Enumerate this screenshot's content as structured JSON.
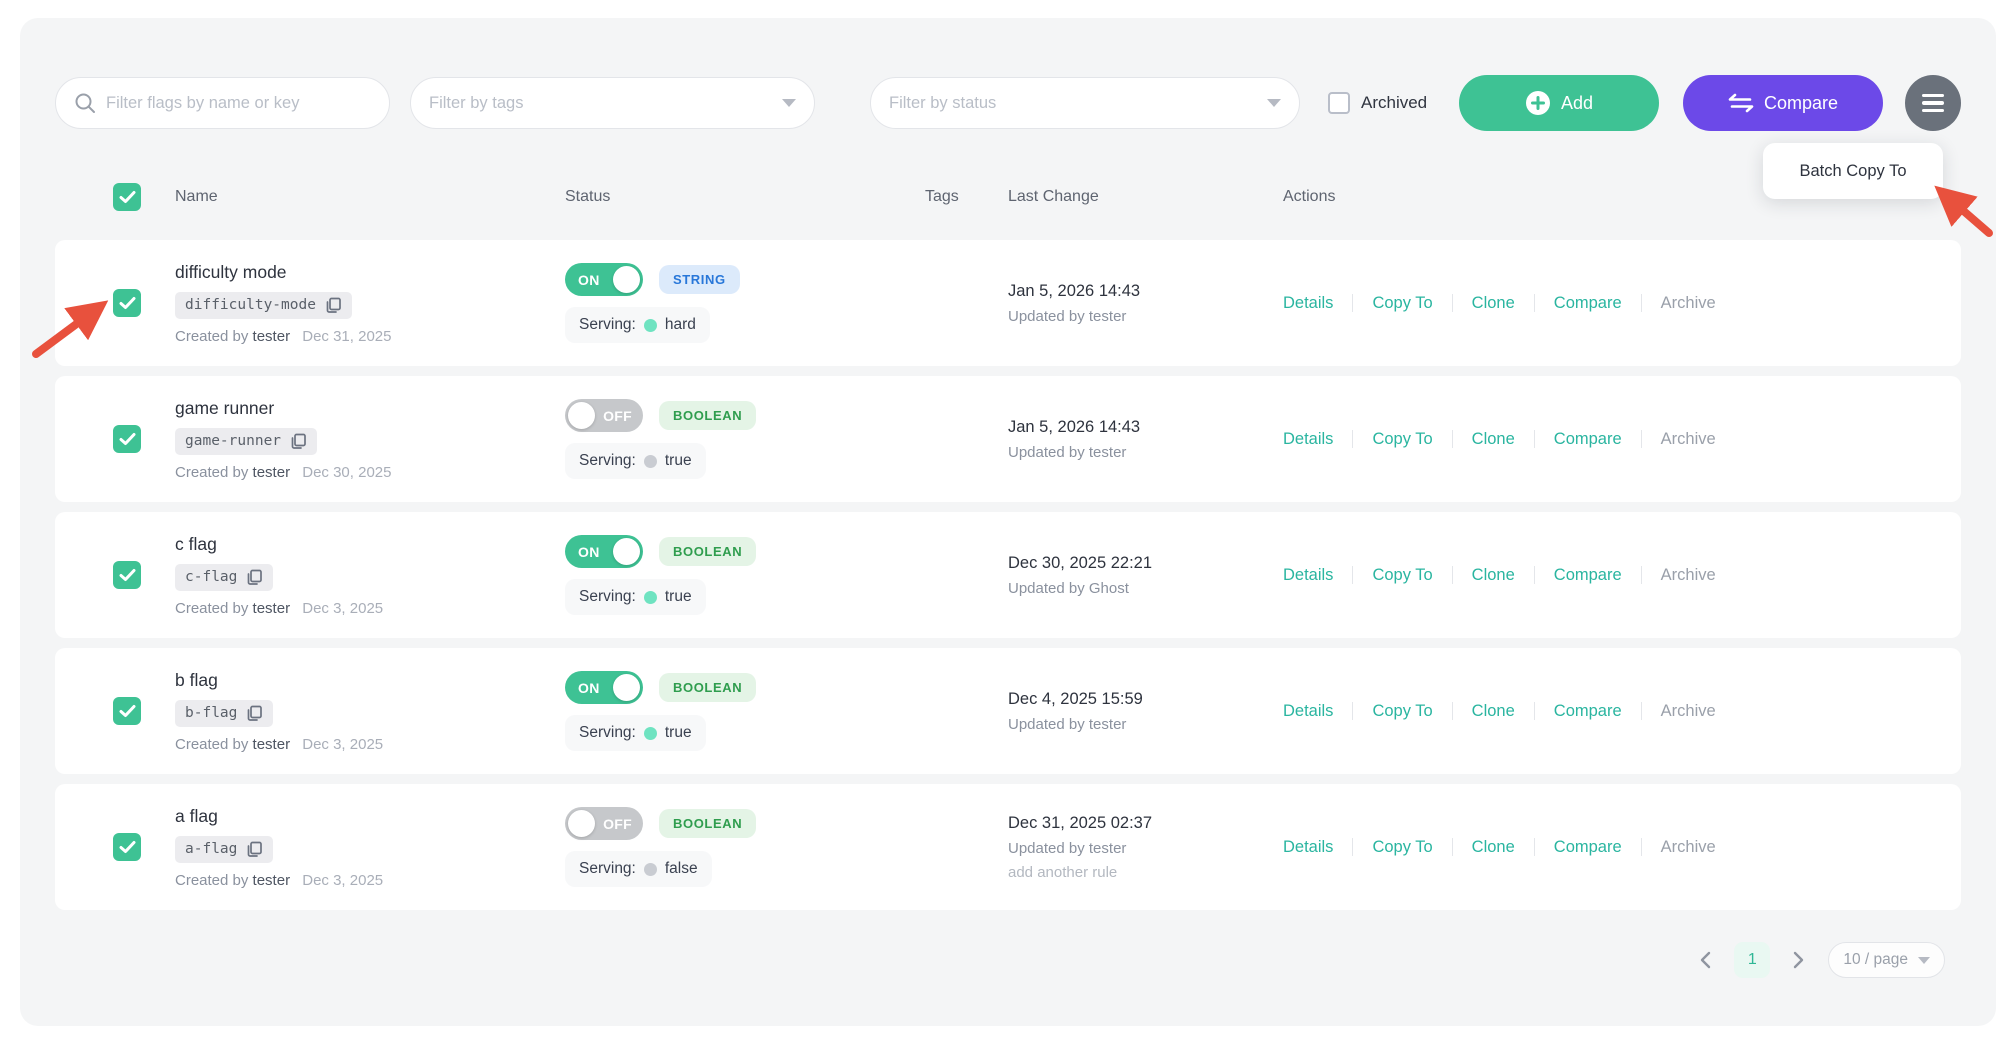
{
  "filters": {
    "search_placeholder": "Filter flags by name or key",
    "tags_placeholder": "Filter by tags",
    "status_placeholder": "Filter by status",
    "archived_label": "Archived"
  },
  "toolbar": {
    "add_label": "Add",
    "compare_label": "Compare",
    "menu_popover_label": "Batch Copy To"
  },
  "table": {
    "headers": {
      "name": "Name",
      "status": "Status",
      "tags": "Tags",
      "last_change": "Last Change",
      "actions": "Actions"
    },
    "rows": [
      {
        "name": "difficulty mode",
        "key": "difficulty-mode",
        "created_prefix": "Created by",
        "created_user": "tester",
        "created_date": "Dec 31, 2025",
        "toggle_label": "ON",
        "enabled": true,
        "type": "STRING",
        "serving_label": "Serving:",
        "serving_value": "hard",
        "serving_on": true,
        "changed_at": "Jan 5, 2026 14:43",
        "updated_by": "Updated by tester",
        "extra": "",
        "actions": [
          {
            "label": "Details"
          },
          {
            "label": "Copy To"
          },
          {
            "label": "Clone"
          },
          {
            "label": "Compare"
          },
          {
            "label": "Archive",
            "muted": true
          }
        ]
      },
      {
        "name": "game runner",
        "key": "game-runner",
        "created_prefix": "Created by",
        "created_user": "tester",
        "created_date": "Dec 30, 2025",
        "toggle_label": "OFF",
        "enabled": false,
        "type": "BOOLEAN",
        "serving_label": "Serving:",
        "serving_value": "true",
        "serving_on": false,
        "changed_at": "Jan 5, 2026 14:43",
        "updated_by": "Updated by tester",
        "extra": "",
        "actions": [
          {
            "label": "Details"
          },
          {
            "label": "Copy To"
          },
          {
            "label": "Clone"
          },
          {
            "label": "Compare"
          },
          {
            "label": "Archive",
            "muted": true
          }
        ]
      },
      {
        "name": "c flag",
        "key": "c-flag",
        "created_prefix": "Created by",
        "created_user": "tester",
        "created_date": "Dec 3, 2025",
        "toggle_label": "ON",
        "enabled": true,
        "type": "BOOLEAN",
        "serving_label": "Serving:",
        "serving_value": "true",
        "serving_on": true,
        "changed_at": "Dec 30, 2025 22:21",
        "updated_by": "Updated by Ghost",
        "extra": "",
        "actions": [
          {
            "label": "Details"
          },
          {
            "label": "Copy To"
          },
          {
            "label": "Clone"
          },
          {
            "label": "Compare"
          },
          {
            "label": "Archive",
            "muted": true
          }
        ]
      },
      {
        "name": "b flag",
        "key": "b-flag",
        "created_prefix": "Created by",
        "created_user": "tester",
        "created_date": "Dec 3, 2025",
        "toggle_label": "ON",
        "enabled": true,
        "type": "BOOLEAN",
        "serving_label": "Serving:",
        "serving_value": "true",
        "serving_on": true,
        "changed_at": "Dec 4, 2025 15:59",
        "updated_by": "Updated by tester",
        "extra": "",
        "actions": [
          {
            "label": "Details"
          },
          {
            "label": "Copy To"
          },
          {
            "label": "Clone"
          },
          {
            "label": "Compare"
          },
          {
            "label": "Archive",
            "muted": true
          }
        ]
      },
      {
        "name": "a flag",
        "key": "a-flag",
        "created_prefix": "Created by",
        "created_user": "tester",
        "created_date": "Dec 3, 2025",
        "toggle_label": "OFF",
        "enabled": false,
        "type": "BOOLEAN",
        "serving_label": "Serving:",
        "serving_value": "false",
        "serving_on": false,
        "changed_at": "Dec 31, 2025 02:37",
        "updated_by": "Updated by tester",
        "extra": "add another rule",
        "actions": [
          {
            "label": "Details"
          },
          {
            "label": "Copy To"
          },
          {
            "label": "Clone"
          },
          {
            "label": "Compare"
          },
          {
            "label": "Archive",
            "muted": true
          }
        ]
      }
    ]
  },
  "pagination": {
    "current_page": "1",
    "page_size_label": "10 / page"
  },
  "colors": {
    "accent_green": "#3ec294",
    "accent_purple": "#6c49e8",
    "link_teal": "#2ab5a0",
    "badge_string_text": "#2877d9",
    "badge_boolean_text": "#2f9d4e",
    "annotation_red": "#e8513d",
    "panel_bg": "#f4f5f6"
  }
}
